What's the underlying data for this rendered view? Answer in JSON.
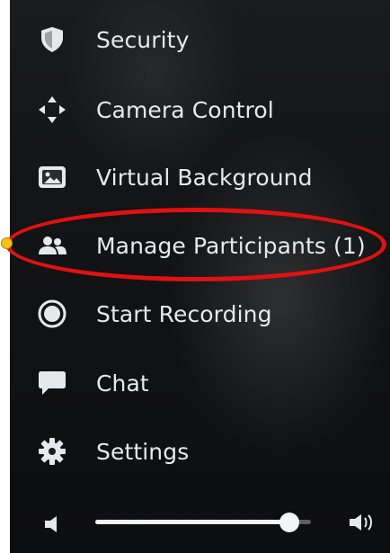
{
  "menu": {
    "items": [
      {
        "label": "Security",
        "icon": "shield-icon"
      },
      {
        "label": "Camera Control",
        "icon": "camera-control-icon"
      },
      {
        "label": "Virtual Background",
        "icon": "virtual-background-icon"
      },
      {
        "label": "Manage Participants (1)",
        "icon": "participants-icon"
      },
      {
        "label": "Start Recording",
        "icon": "record-icon"
      },
      {
        "label": "Chat",
        "icon": "chat-icon"
      },
      {
        "label": "Settings",
        "icon": "gear-icon"
      }
    ]
  },
  "volume": {
    "level": 0.9,
    "low_icon": "volume-low-icon",
    "high_icon": "volume-high-icon"
  },
  "annotation": {
    "highlight_color": "#e11111",
    "pointer_color": "#f2c21a"
  }
}
